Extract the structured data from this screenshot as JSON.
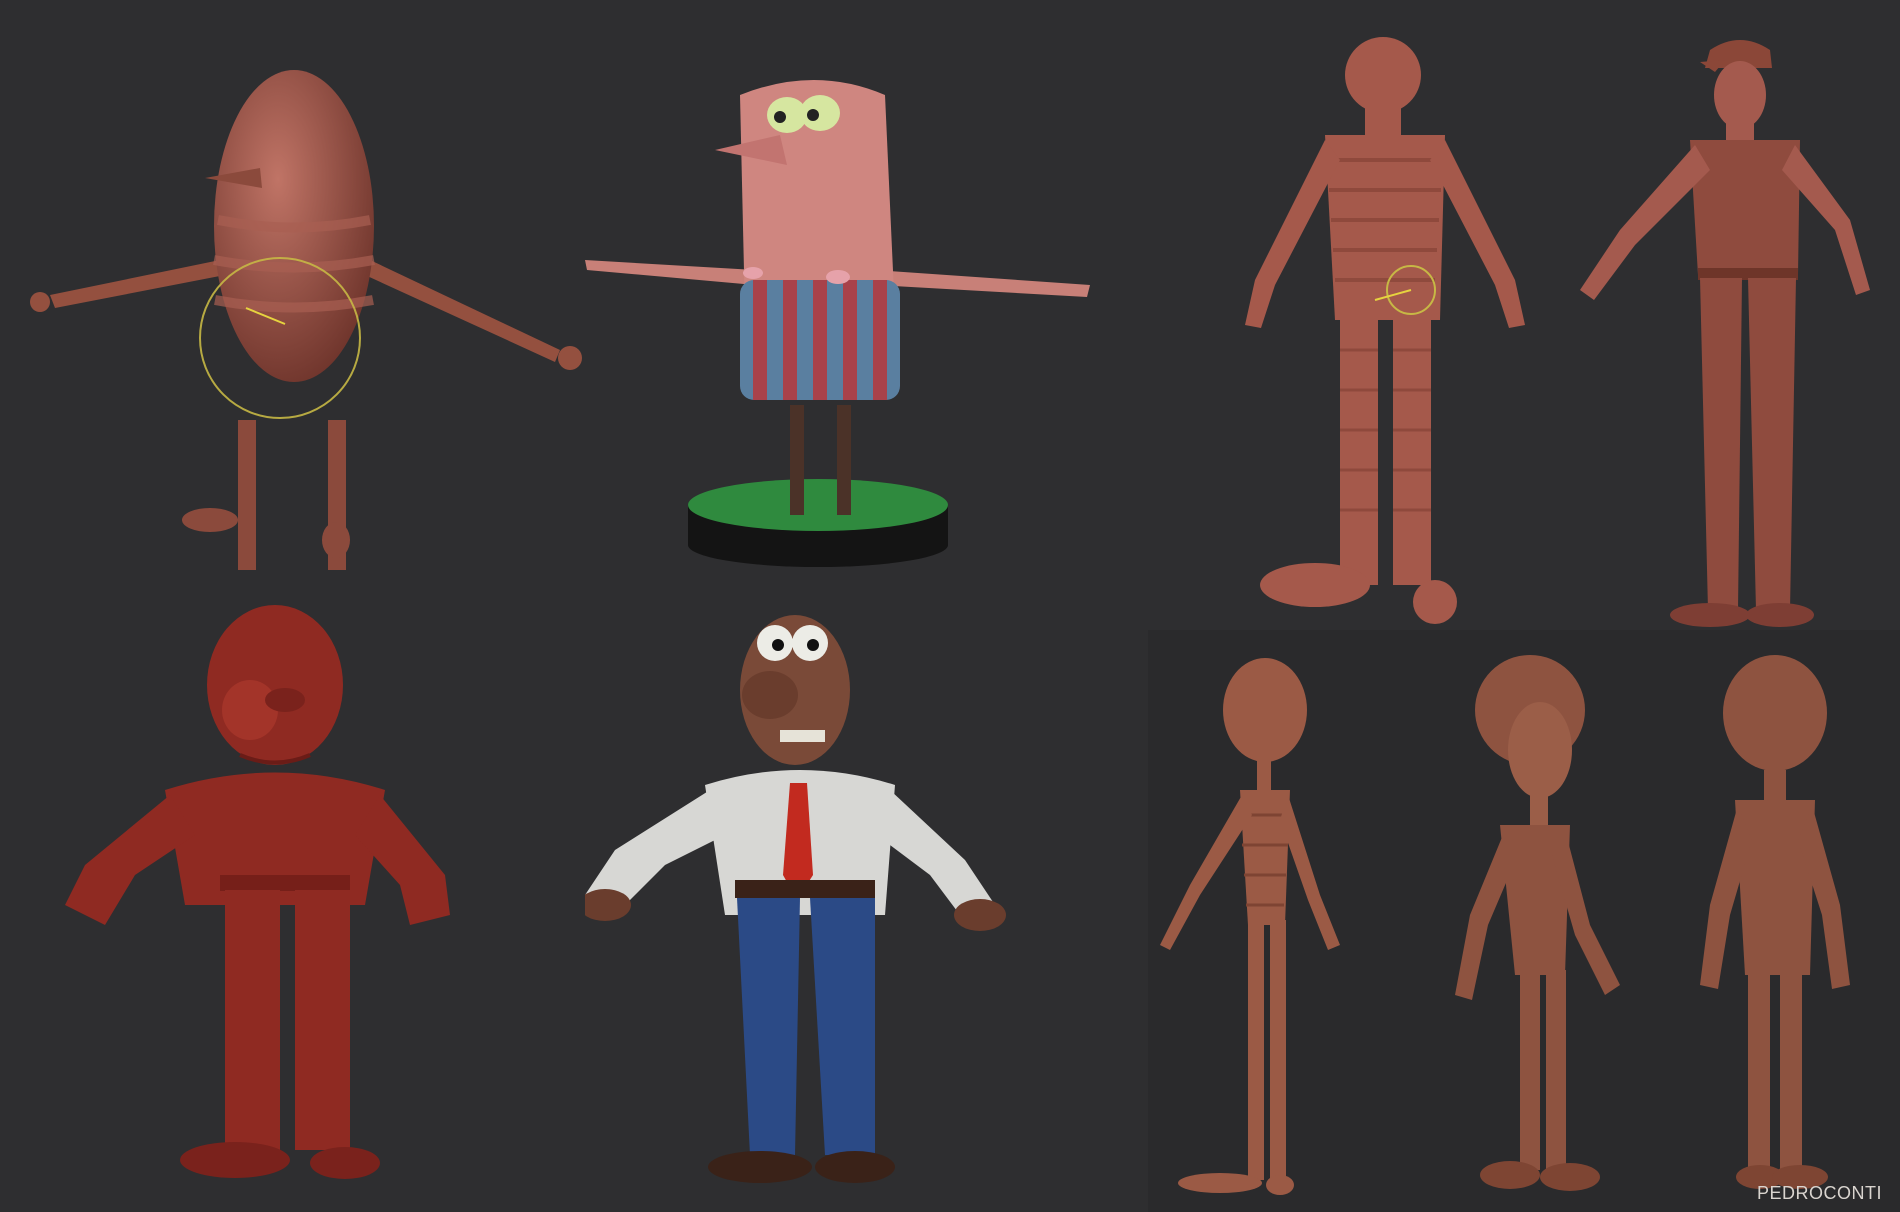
{
  "signature": "PEDROCONTI",
  "colors": {
    "background": "#2e2e30",
    "clay": "#a45a4e",
    "clay_dark": "#7e3e34",
    "skin": "#c97c76",
    "red_clay": "#8f2a22",
    "brown_clay": "#8e5340",
    "shirt": "#d7d7d4",
    "tie": "#c22a1f",
    "jeans": "#2b4a86",
    "base_green": "#2f8a3e",
    "base_black": "#141414",
    "shorts_red": "#a8424a",
    "shorts_blue": "#5a7fa0",
    "cursor_ring": "#c7b845"
  },
  "figures": [
    {
      "id": "egg-mannequin",
      "icon": "egg-body-figure"
    },
    {
      "id": "pink-cartoon-man",
      "icon": "cartoon-man-with-shorts"
    },
    {
      "id": "segmented-mannequin",
      "icon": "segmented-humanoid"
    },
    {
      "id": "muscular-man-in-cap",
      "icon": "realistic-man"
    },
    {
      "id": "red-clay-man",
      "icon": "clay-man"
    },
    {
      "id": "painted-man-with-tie",
      "icon": "man-in-shirt-and-tie"
    },
    {
      "id": "thin-mannequin",
      "icon": "thin-humanoid"
    },
    {
      "id": "long-hair-man-front",
      "icon": "thin-man-side"
    },
    {
      "id": "long-hair-man-back",
      "icon": "thin-man-back"
    }
  ]
}
